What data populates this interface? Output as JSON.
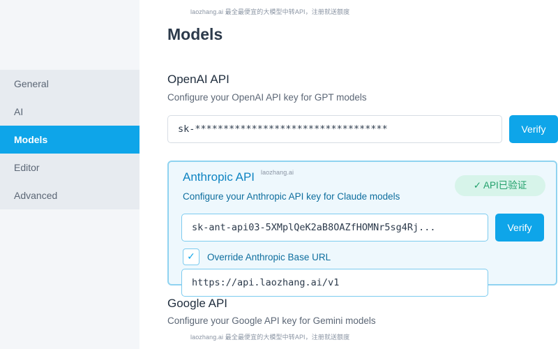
{
  "sidebar": {
    "items": [
      {
        "label": "General"
      },
      {
        "label": "AI"
      },
      {
        "label": "Models"
      },
      {
        "label": "Editor"
      },
      {
        "label": "Advanced"
      }
    ],
    "active": "Models"
  },
  "watermark": {
    "top": "laozhang.ai 最全最便宜的大模型中转API，注册就送额度",
    "bottom": "laozhang.ai 最全最便宜的大模型中转API，注册就送额度",
    "inline": "laozhang.ai"
  },
  "page": {
    "title": "Models"
  },
  "openai": {
    "title": "OpenAI API",
    "subtitle": "Configure your OpenAI API key for GPT models",
    "key_value": "sk-**********************************",
    "verify_label": "Verify"
  },
  "anthropic": {
    "title": "Anthropic API",
    "subtitle": "Configure your Anthropic API key for Claude models",
    "verified_badge": "✓ API已验证",
    "key_value": "sk-ant-api03-5XMplQeK2aB8OAZfHOMNr5sg4Rj...",
    "verify_label": "Verify",
    "override_checked": true,
    "checkbox_mark": "✓",
    "override_label": "Override Anthropic Base URL",
    "base_url_value": "https://api.laozhang.ai/v1"
  },
  "google": {
    "title": "Google API",
    "subtitle": "Configure your Google API key for Gemini models"
  },
  "colors": {
    "accent": "#0ea5e9",
    "verified": "#22a06b",
    "sidebar_bg": "#f4f6f9"
  }
}
